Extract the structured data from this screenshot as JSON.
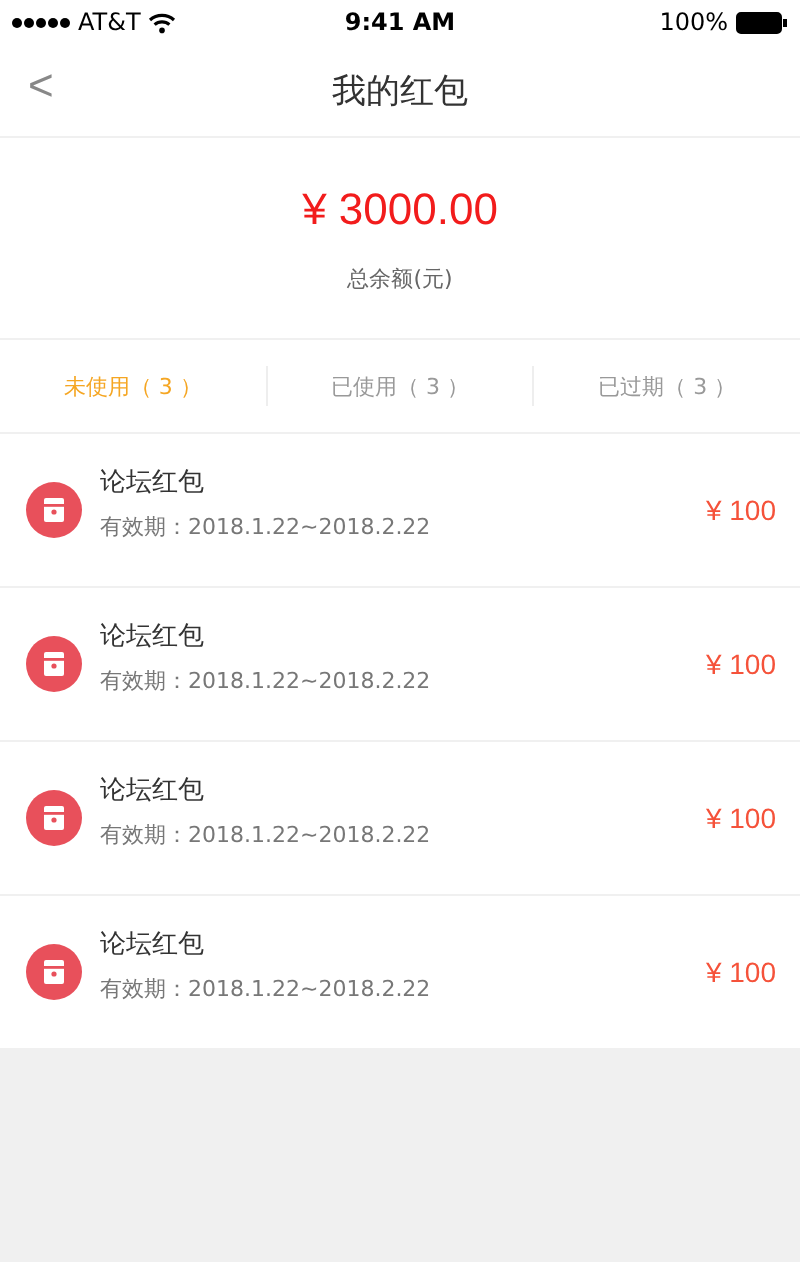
{
  "status_bar": {
    "carrier": "AT&T",
    "time": "9:41 AM",
    "battery": "100%"
  },
  "nav": {
    "back": "<",
    "title": "我的红包"
  },
  "balance": {
    "amount": "¥ 3000.00",
    "label": "总余额(元)"
  },
  "tabs": [
    {
      "label": "未使用（ 3 ）",
      "selected": true
    },
    {
      "label": "已使用（ 3 ）",
      "selected": false
    },
    {
      "label": "已过期（ 3 ）",
      "selected": false
    }
  ],
  "items": [
    {
      "title": "论坛红包",
      "validity": "有效期：2018.1.22~2018.2.22",
      "amount": "¥ 100"
    },
    {
      "title": "论坛红包",
      "validity": "有效期：2018.1.22~2018.2.22",
      "amount": "¥ 100"
    },
    {
      "title": "论坛红包",
      "validity": "有效期：2018.1.22~2018.2.22",
      "amount": "¥ 100"
    },
    {
      "title": "论坛红包",
      "validity": "有效期：2018.1.22~2018.2.22",
      "amount": "¥ 100"
    }
  ]
}
